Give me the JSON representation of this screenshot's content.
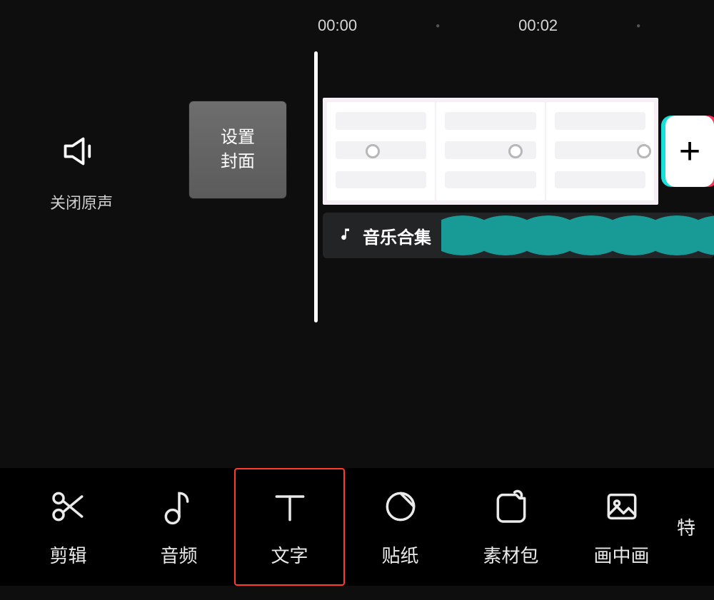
{
  "ruler": {
    "marks": [
      "00:00",
      "00:02"
    ]
  },
  "sidebar": {
    "mute_label": "关闭原声",
    "cover_label": "设置封面"
  },
  "timeline": {
    "audio_name": "音乐合集",
    "add_label": "+"
  },
  "toolbar": {
    "items": [
      {
        "id": "cut",
        "label": "剪辑",
        "icon": "scissors-icon",
        "selected": false
      },
      {
        "id": "audio",
        "label": "音频",
        "icon": "music-note-icon",
        "selected": false
      },
      {
        "id": "text",
        "label": "文字",
        "icon": "text-icon",
        "selected": true
      },
      {
        "id": "sticker",
        "label": "贴纸",
        "icon": "sticker-icon",
        "selected": false
      },
      {
        "id": "pack",
        "label": "素材包",
        "icon": "pack-icon",
        "selected": false
      },
      {
        "id": "pip",
        "label": "画中画",
        "icon": "pip-icon",
        "selected": false
      },
      {
        "id": "fx",
        "label": "特",
        "icon": "none",
        "selected": false
      }
    ]
  }
}
